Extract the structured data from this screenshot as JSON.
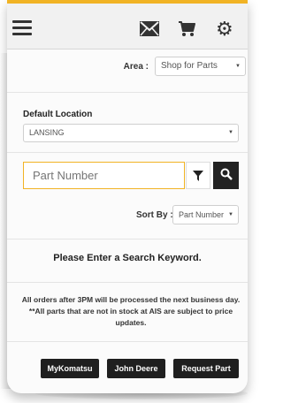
{
  "header": {
    "icons": [
      "menu-icon",
      "mail-icon",
      "cart-icon",
      "gear-icon"
    ],
    "accent_color": "#f1b324"
  },
  "area": {
    "label": "Area :",
    "selected": "Shop for Parts"
  },
  "location": {
    "label": "Default Location",
    "selected": "LANSING"
  },
  "search": {
    "placeholder": "Part Number",
    "value": ""
  },
  "sort": {
    "label": "Sort By :",
    "selected": "Part Number"
  },
  "message": "Please Enter a Search Keyword.",
  "notice": "All orders after 3PM will be processed the next business day. **All parts that are not in stock at AIS are subject to price updates.",
  "buttons": {
    "mykomatsu": "MyKomatsu",
    "john_deere": "John Deere",
    "request_part": "Request Part"
  }
}
